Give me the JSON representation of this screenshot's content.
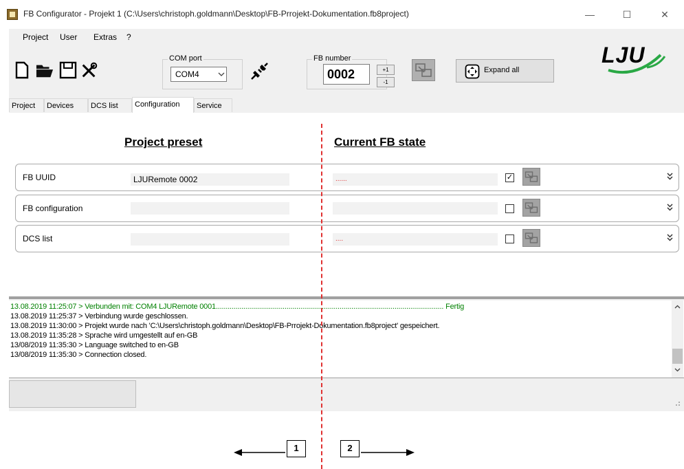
{
  "window": {
    "title": "FB Configurator - Projekt 1 (C:\\Users\\christoph.goldmann\\Desktop\\FB-Prrojekt-Dokumentation.fb8project)",
    "minimize": "—",
    "maximize": "☐",
    "close": "✕"
  },
  "menu": {
    "items": [
      "Project",
      "User",
      "Extras",
      "?"
    ]
  },
  "toolbar": {
    "com_port_label": "COM port",
    "com_port_value": "COM4",
    "fb_number_label": "FB number",
    "fb_number_value": "0002",
    "increment_label": "+1",
    "decrement_label": "-1",
    "expand_all_label": "Expand all",
    "logo_text": "LJU"
  },
  "tabs": [
    {
      "label": "Project",
      "active": false
    },
    {
      "label": "Devices",
      "active": false
    },
    {
      "label": "DCS list",
      "active": false
    },
    {
      "label": "Configuration",
      "active": true
    },
    {
      "label": "Service",
      "active": false
    }
  ],
  "configuration": {
    "project_preset_heading": "Project preset",
    "current_state_heading": "Current FB state",
    "rows": [
      {
        "label": "FB UUID",
        "preset": "LJURemote 0002",
        "current": "......",
        "checked": true
      },
      {
        "label": "FB configuration",
        "preset": "",
        "current": "",
        "checked": false
      },
      {
        "label": "DCS list",
        "preset": "",
        "current": "....",
        "checked": false
      }
    ]
  },
  "log": {
    "lines": [
      {
        "text": "13.08.2019 11:25:07 > Verbunden mit: COM4 LJURemote 0001.................................................................................................................... Fertig",
        "color": "#008000"
      },
      {
        "text": "13.08.2019 11:25:37 > Verbindung wurde geschlossen.",
        "color": "#000000"
      },
      {
        "text": "13.08.2019 11:30:00 > Projekt wurde nach 'C:\\Users\\christoph.goldmann\\Desktop\\FB-Prrojekt-Dokumentation.fb8project' gespeichert.",
        "color": "#000000"
      },
      {
        "text": "13.08.2019 11:35:28 > Sprache wird umgestellt auf en-GB",
        "color": "#000000"
      },
      {
        "text": "13/08/2019 11:35:30 > Language switched to en-GB",
        "color": "#000000"
      },
      {
        "text": "13/08/2019 11:35:30 > Connection closed.",
        "color": "#000000"
      }
    ]
  },
  "annotations": {
    "left_number": "1",
    "right_number": "2"
  },
  "colors": {
    "accent_green": "#2aa845",
    "divider_red": "#e03030",
    "log_green": "#008000",
    "placeholder_red": "#e03030"
  }
}
